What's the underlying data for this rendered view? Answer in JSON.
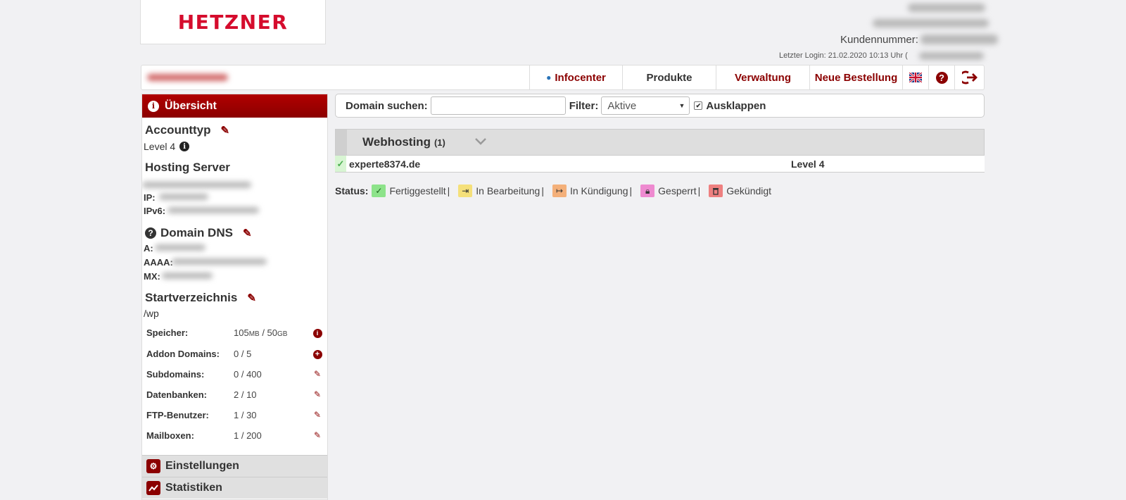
{
  "brand": {
    "logo_text": "HETZNER"
  },
  "account": {
    "customer_number_label": "Kundennummer:",
    "last_login": "Letzter Login: 21.02.2020 10:13 Uhr ("
  },
  "topnav": {
    "items": [
      {
        "label": "Infocenter"
      },
      {
        "label": "Produkte"
      },
      {
        "label": "Verwaltung"
      },
      {
        "label": "Neue Bestellung"
      }
    ]
  },
  "sidebar": {
    "header": "Übersicht",
    "accounttyp_title": "Accounttyp",
    "accounttyp_value": "Level 4",
    "hosting_server_title": "Hosting Server",
    "ip_label": "IP:",
    "ipv6_label": "IPv6:",
    "dns_title": "Domain DNS",
    "dns_a_label": "A:",
    "dns_aaaa_label": "AAAA:",
    "dns_mx_label": "MX:",
    "start_title": "Startverzeichnis",
    "start_value": "/wp",
    "stats": [
      {
        "label": "Speicher:",
        "value_a": "105",
        "unit_a": "MB",
        "value_b": " / 50",
        "unit_b": "GB",
        "action": "info"
      },
      {
        "label": "Addon Domains:",
        "value": "0 / 5",
        "action": "add"
      },
      {
        "label": "Subdomains:",
        "value": "0 / 400",
        "action": "edit"
      },
      {
        "label": "Datenbanken:",
        "value": "2 / 10",
        "action": "edit"
      },
      {
        "label": "FTP-Benutzer:",
        "value": "1 / 30",
        "action": "edit"
      },
      {
        "label": "Mailboxen:",
        "value": "1 / 200",
        "action": "edit"
      }
    ],
    "footer_items": [
      {
        "label": "Einstellungen",
        "icon": "gears-icon"
      },
      {
        "label": "Statistiken",
        "icon": "chart-icon"
      }
    ]
  },
  "search": {
    "label": "Domain suchen:",
    "value": "",
    "filter_label": "Filter:",
    "filter_value": "Aktive",
    "expand_label": "Ausklappen",
    "expand_checked": true
  },
  "webhosting": {
    "title": "Webhosting",
    "count": "(1)",
    "rows": [
      {
        "domain": "experte8374.de",
        "level": "Level 4",
        "status": "fertiggestellt"
      }
    ]
  },
  "status_legend": {
    "label": "Status:",
    "items": [
      {
        "label": "Fertiggestellt",
        "color": "#8de38a",
        "icon": "check-icon"
      },
      {
        "label": "In Bearbeitung",
        "color": "#f5e07a",
        "icon": "sign-in-icon"
      },
      {
        "label": "In Kündigung",
        "color": "#f4b07a",
        "icon": "sign-out-icon"
      },
      {
        "label": "Gesperrt",
        "color": "#ee8ad0",
        "icon": "lock-icon"
      },
      {
        "label": "Gekündigt",
        "color": "#ee8080",
        "icon": "trash-icon"
      }
    ]
  },
  "colors": {
    "accent": "#8b0000",
    "brand": "#d50c2d",
    "background": "#f1f1f3"
  }
}
